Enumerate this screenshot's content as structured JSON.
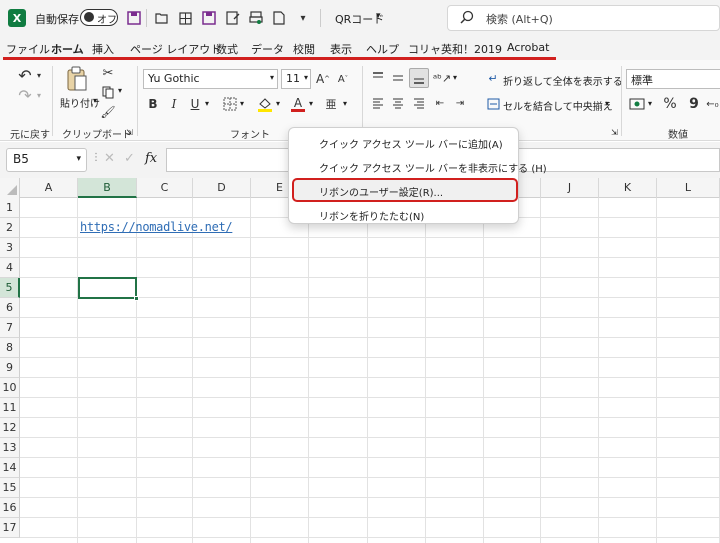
{
  "titlebar": {
    "autosave_label": "自動保存",
    "autosave_state": "オフ",
    "qr_label": "QRコード",
    "search_placeholder": "検索 (Alt+Q)"
  },
  "tabs": [
    {
      "label": "ファイル"
    },
    {
      "label": "ホーム"
    },
    {
      "label": "挿入"
    },
    {
      "label": "ページ レイアウト"
    },
    {
      "label": "数式"
    },
    {
      "label": "データ"
    },
    {
      "label": "校閲"
    },
    {
      "label": "表示"
    },
    {
      "label": "ヘルプ"
    },
    {
      "label": "コリャ英和！2019"
    },
    {
      "label": "Acrobat"
    }
  ],
  "ribbon": {
    "undo_group_label": "元に戻す",
    "clipboard_group_label": "クリップボード",
    "paste_label": "貼り付け",
    "font_group_label": "フォント",
    "font_name": "Yu Gothic",
    "font_size": "11",
    "bold": "B",
    "italic": "I",
    "underline": "U",
    "wrap_text": "折り返して全体を表示する",
    "merge_center": "セルを結合して中央揃え",
    "number_format": "標準",
    "number_group_label": "数値",
    "percent": "%",
    "comma": "9",
    "font_color": "#d1201e",
    "highlight_color": "#ffe600"
  },
  "formula_bar": {
    "name_box": "B5",
    "fx": "fx"
  },
  "grid": {
    "columns": [
      "A",
      "B",
      "C",
      "D",
      "E",
      "F",
      "G",
      "H",
      "I",
      "J",
      "K",
      "L"
    ],
    "rows": [
      "1",
      "2",
      "3",
      "4",
      "5",
      "6",
      "7",
      "8",
      "9",
      "10",
      "11",
      "12",
      "13",
      "14",
      "15",
      "16",
      "17"
    ],
    "cell_b2": "https://nomadlive.net/",
    "selected_cell": "B5"
  },
  "context_menu": {
    "items": [
      "クイック アクセス ツール バーに追加(A)",
      "クイック アクセス ツール バーを非表示にする (H)",
      "リボンのユーザー設定(R)...",
      "リボンを折りたたむ(N)"
    ]
  },
  "colors": {
    "accent_red": "#d1201e",
    "excel_green": "#107c41",
    "selection_green": "#217346",
    "link_blue": "#2f6db5"
  }
}
